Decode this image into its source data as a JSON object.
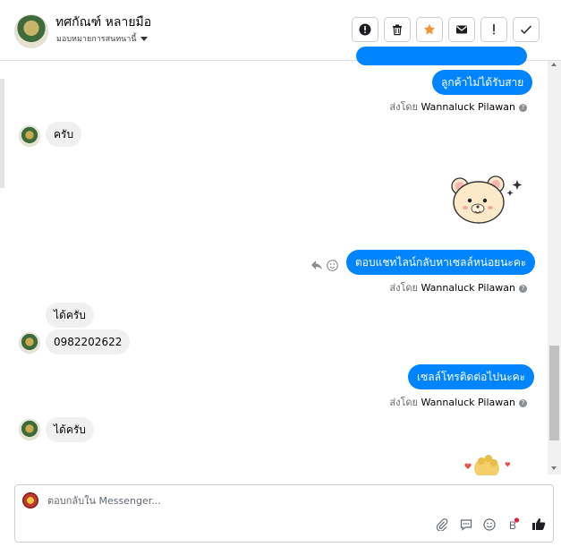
{
  "header": {
    "name": "ทศกัณฑ์ หลายมือ",
    "assign_label": "มอบหมายการสนทนานี้",
    "toolbar": [
      "mark-spam",
      "delete",
      "star",
      "mark-unread",
      "flag",
      "done"
    ]
  },
  "messages": {
    "out1": "ลูกค้าไม่ได้รับสาย",
    "sent_by_prefix": "ส่งโดย",
    "sent_by_name": "Wannaluck Pilawan",
    "in1": "ครับ",
    "out2": "ตอบแชทไลน์กลับหาเซลล์หน่อยนะคะ",
    "in2": "ได้ครับ",
    "in3": "0982202622",
    "out3": "เซลล์โทรติดต่อไปนะคะ",
    "in4": "ได้ครับ"
  },
  "composer": {
    "placeholder": "ตอบกลับใน Messenger..."
  },
  "colors": {
    "outgoing_bubble": "#0084ff",
    "incoming_bubble": "#f0f0f0",
    "like": "#1877f2",
    "star": "#f7923a"
  }
}
